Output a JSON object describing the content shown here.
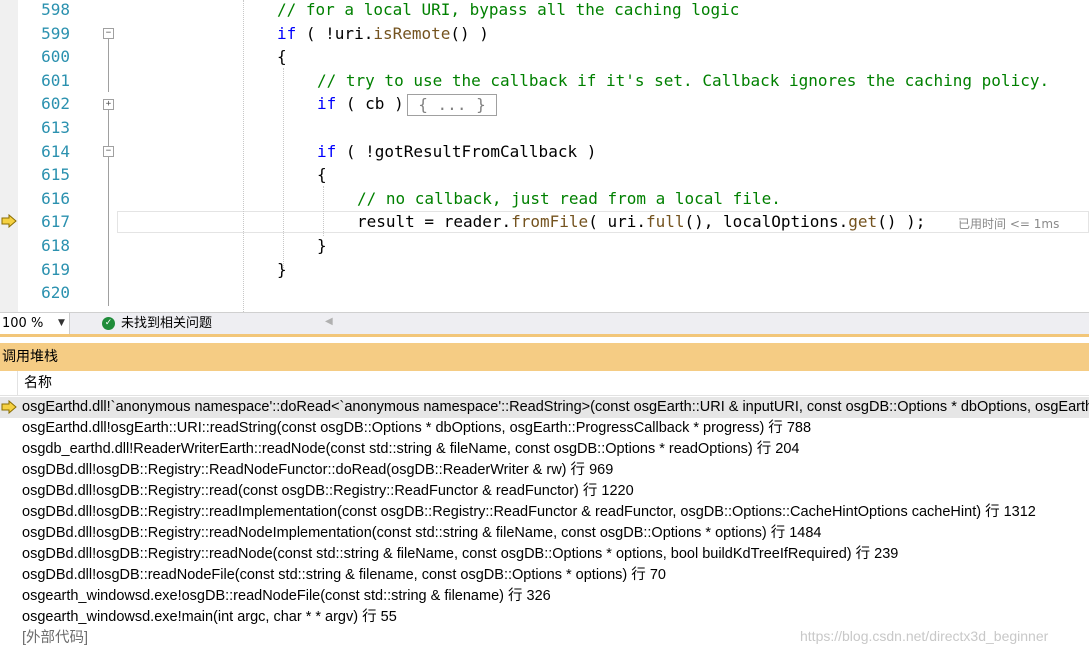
{
  "editor": {
    "lines": [
      {
        "num": "598",
        "code": [
          {
            "c": "cm",
            "t": "// for a local URI, bypass all the caching logic"
          }
        ]
      },
      {
        "num": "599",
        "code": [
          {
            "c": "kw",
            "t": "if"
          },
          {
            "c": "",
            "t": " ( !uri."
          },
          {
            "c": "fn",
            "t": "isRemote"
          },
          {
            "c": "",
            "t": "() )"
          }
        ]
      },
      {
        "num": "600",
        "code": [
          {
            "c": "",
            "t": "{"
          }
        ]
      },
      {
        "num": "601",
        "code": [
          {
            "c": "cm",
            "t": "// try to use the callback if it's set. Callback ignores the caching policy."
          }
        ]
      },
      {
        "num": "602",
        "code": [
          {
            "c": "kw",
            "t": "if"
          },
          {
            "c": "",
            "t": " ( cb )"
          }
        ]
      },
      {
        "num": "613",
        "code": []
      },
      {
        "num": "614",
        "code": [
          {
            "c": "kw",
            "t": "if"
          },
          {
            "c": "",
            "t": " ( !gotResultFromCallback )"
          }
        ]
      },
      {
        "num": "615",
        "code": [
          {
            "c": "",
            "t": "{"
          }
        ]
      },
      {
        "num": "616",
        "code": [
          {
            "c": "cm",
            "t": "// no callback, just read from a local file."
          }
        ]
      },
      {
        "num": "617",
        "code": [
          {
            "c": "",
            "t": "result = reader."
          },
          {
            "c": "fn",
            "t": "fromFile"
          },
          {
            "c": "",
            "t": "( uri."
          },
          {
            "c": "fn",
            "t": "full"
          },
          {
            "c": "",
            "t": "(), localOptions."
          },
          {
            "c": "fn",
            "t": "get"
          },
          {
            "c": "",
            "t": "() );"
          }
        ]
      },
      {
        "num": "618",
        "code": [
          {
            "c": "",
            "t": "}"
          }
        ]
      },
      {
        "num": "619",
        "code": [
          {
            "c": "",
            "t": "}"
          }
        ]
      },
      {
        "num": "620",
        "code": []
      }
    ],
    "collapsed_block": "{ ... }",
    "elapsed_label": "已用时间 <= 1ms",
    "fold_minus": "−",
    "fold_plus": "+"
  },
  "statusbar": {
    "zoom": "100 %",
    "zoom_dropdown": "▼",
    "issues_icon": "✓",
    "issues_text": "未找到相关问题"
  },
  "callstack": {
    "title": "调用堆栈",
    "column_name": "名称",
    "rows": [
      "osgEarthd.dll!`anonymous namespace'::doRead<`anonymous namespace'::ReadString>(const osgEarth::URI & inputURI, const osgDB::Options * dbOptions, osgEarth::ProgressCallback * progress)",
      "osgEarthd.dll!osgEarth::URI::readString(const osgDB::Options * dbOptions, osgEarth::ProgressCallback * progress) 行 788",
      "osgdb_earthd.dll!ReaderWriterEarth::readNode(const std::string & fileName, const osgDB::Options * readOptions) 行 204",
      "osgDBd.dll!osgDB::Registry::ReadNodeFunctor::doRead(osgDB::ReaderWriter & rw) 行 969",
      "osgDBd.dll!osgDB::Registry::read(const osgDB::Registry::ReadFunctor & readFunctor) 行 1220",
      "osgDBd.dll!osgDB::Registry::readImplementation(const osgDB::Registry::ReadFunctor & readFunctor, osgDB::Options::CacheHintOptions cacheHint) 行 1312",
      "osgDBd.dll!osgDB::Registry::readNodeImplementation(const std::string & fileName, const osgDB::Options * options) 行 1484",
      "osgDBd.dll!osgDB::Registry::readNode(const std::string & fileName, const osgDB::Options * options, bool buildKdTreeIfRequired) 行 239",
      "osgDBd.dll!osgDB::readNodeFile(const std::string & filename, const osgDB::Options * options) 行 70",
      "osgearth_windowsd.exe!osgDB::readNodeFile(const std::string & filename) 行 326",
      "osgearth_windowsd.exe!main(int argc, char * * argv) 行 55",
      "[外部代码]"
    ]
  },
  "watermark": "https://blog.csdn.net/directx3d_beginner",
  "colors": {
    "keyword": "#0000ff",
    "comment": "#008000",
    "line_number": "#2b91af",
    "panel_header": "#f5cc84",
    "current_arrow": "#f5d142"
  }
}
